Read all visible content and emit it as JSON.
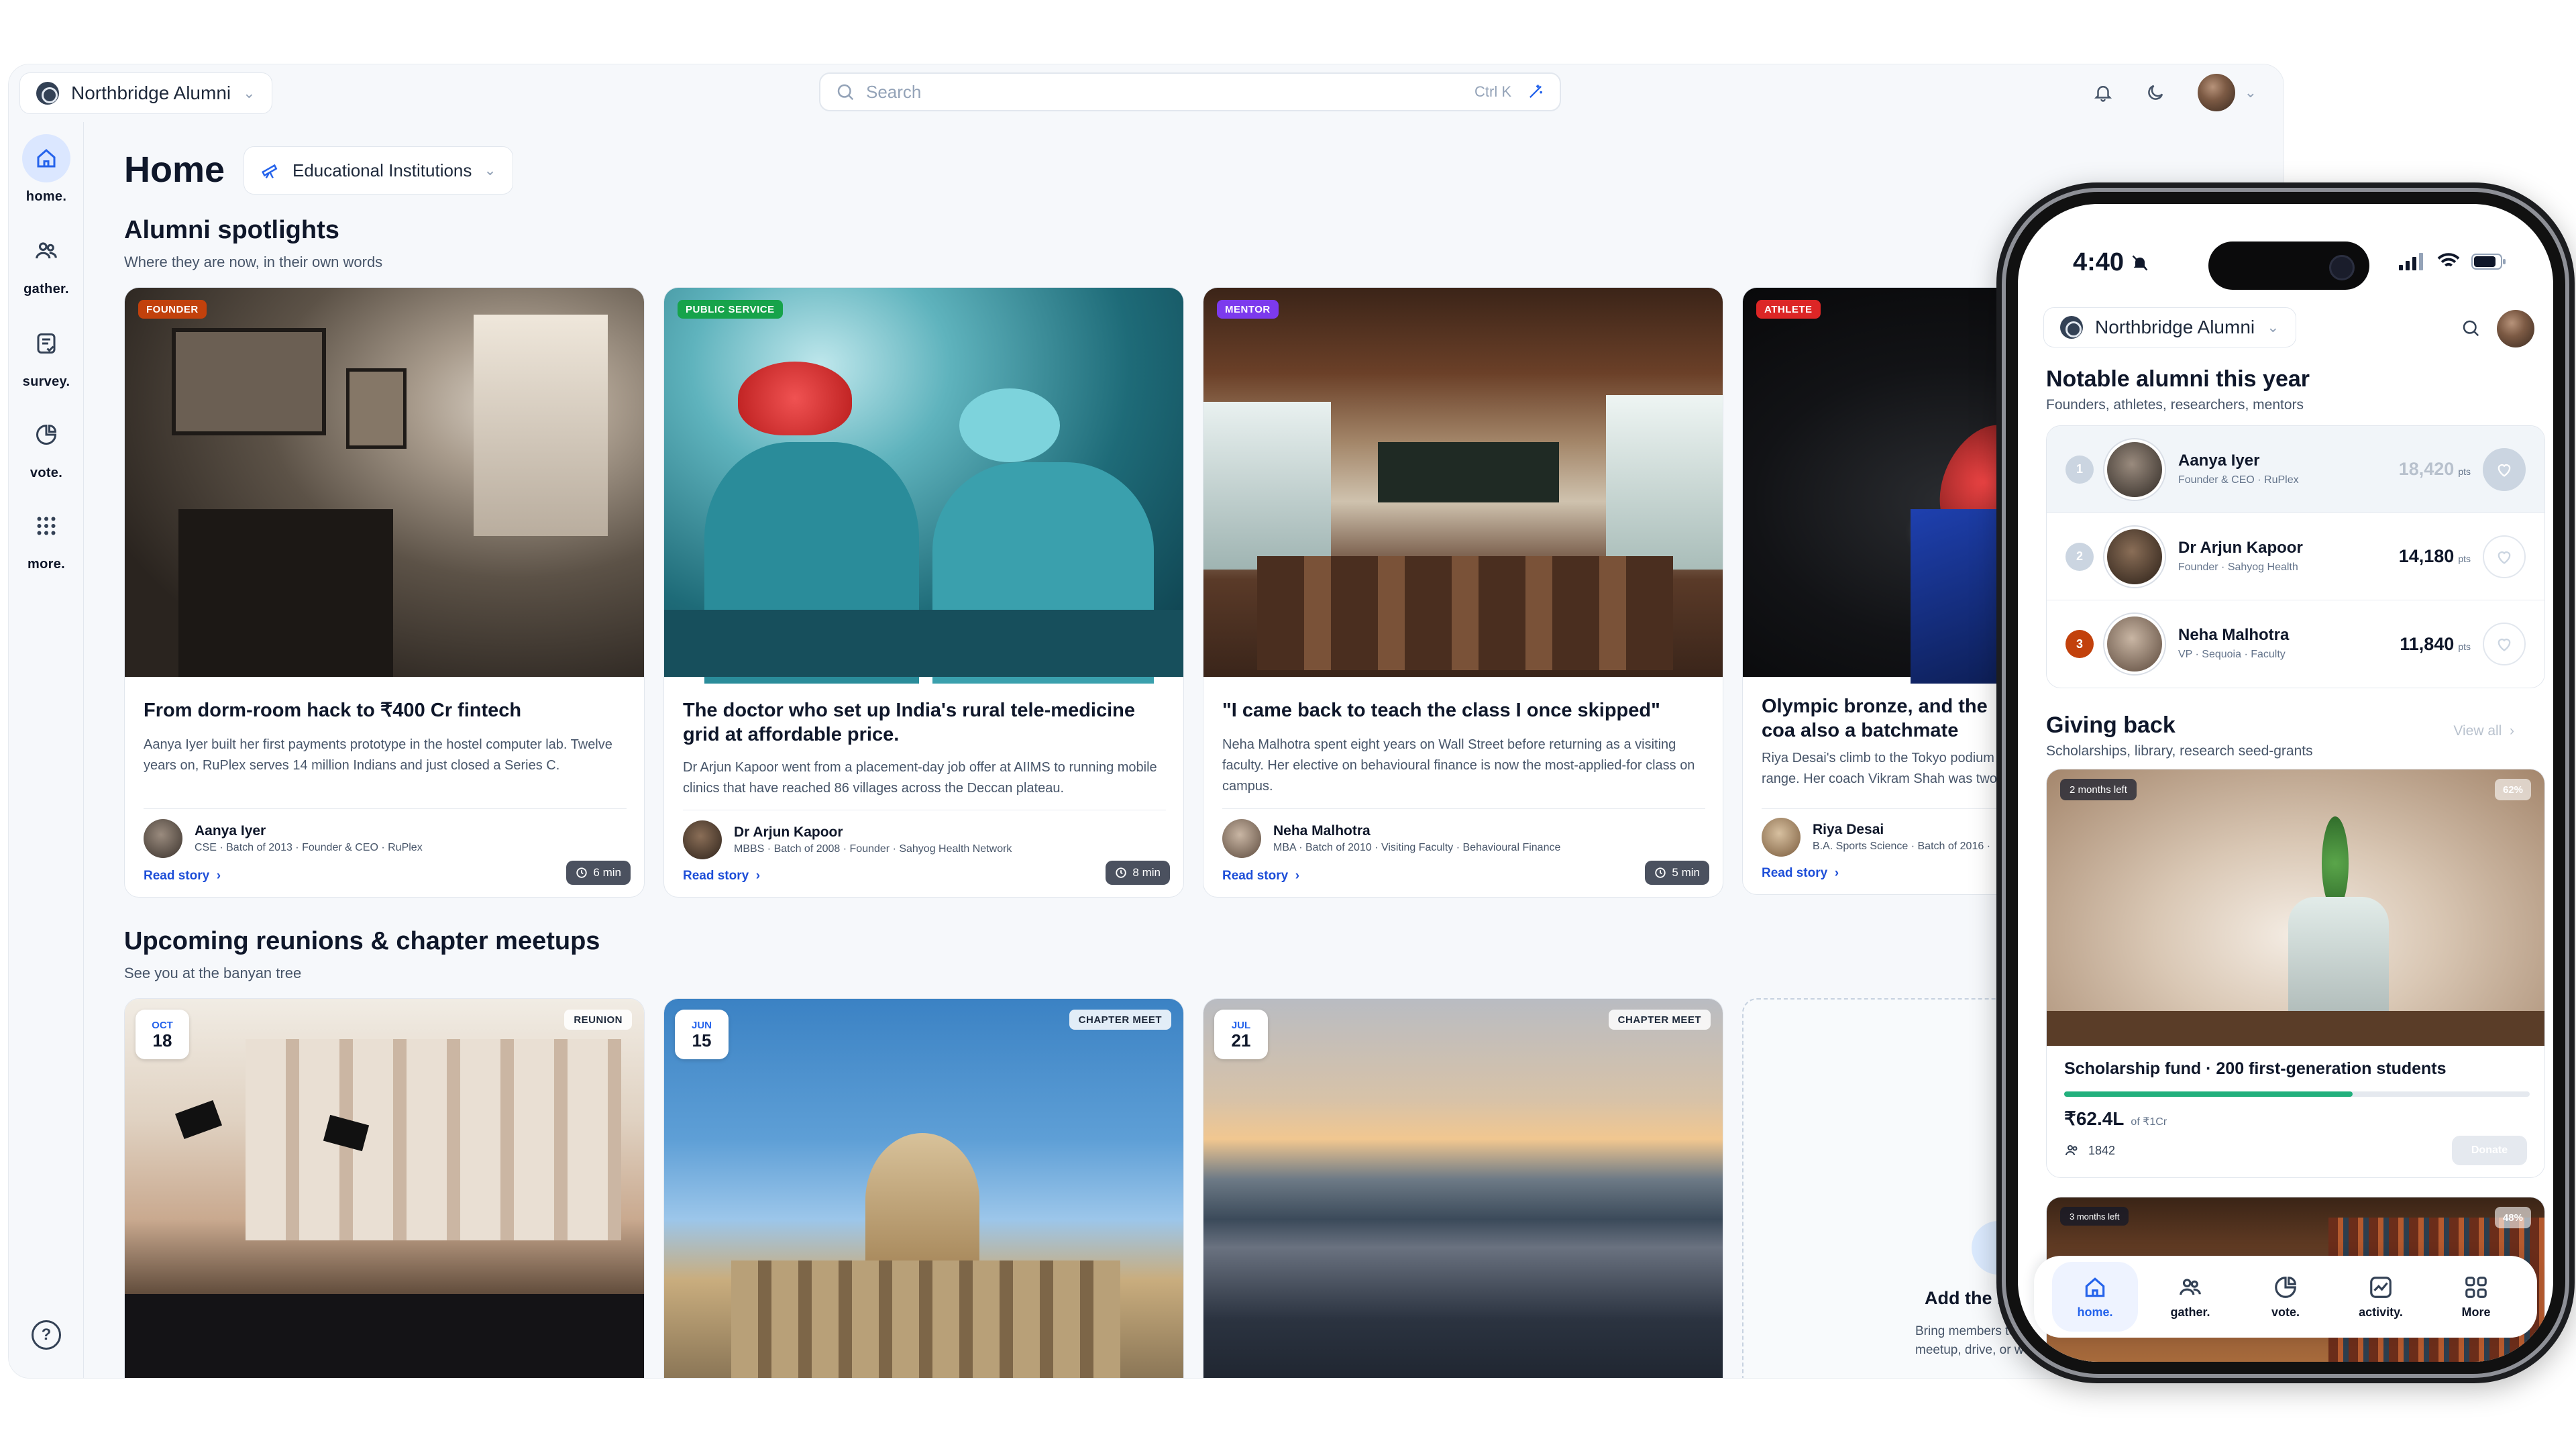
{
  "app": {
    "org_name": "Northbridge Alumni",
    "search_placeholder": "Search",
    "search_shortcut": "Ctrl K"
  },
  "sidebar": {
    "items": [
      {
        "label": "home.",
        "icon": "home-icon"
      },
      {
        "label": "gather.",
        "icon": "people-icon"
      },
      {
        "label": "survey.",
        "icon": "survey-icon"
      },
      {
        "label": "vote.",
        "icon": "pie-icon"
      },
      {
        "label": "more.",
        "icon": "grid-icon"
      }
    ],
    "help": "?"
  },
  "home": {
    "title": "Home",
    "institution_filter": "Educational Institutions",
    "spotlights": {
      "title": "Alumni spotlights",
      "subtitle": "Where they are now, in their own words",
      "cards": [
        {
          "tag": "FOUNDER",
          "tag_color": "#c2410c",
          "read_time": "6 min",
          "title": "From dorm-room hack to ₹400 Cr fintech",
          "desc": "Aanya Iyer built her first payments prototype in the hostel computer lab. Twelve years on, RuPlex serves 14 million Indians and just closed a Series C.",
          "author": "Aanya Iyer",
          "meta": "CSE · Batch of 2013 · Founder & CEO · RuPlex",
          "cta": "Read story"
        },
        {
          "tag": "PUBLIC SERVICE",
          "tag_color": "#16a34a",
          "read_time": "8 min",
          "title": "The doctor who set up India's rural tele-medicine grid at affordable price.",
          "desc": "Dr Arjun Kapoor went from a placement-day job offer at AIIMS to running mobile clinics that have reached 86 villages across the Deccan plateau.",
          "author": "Dr Arjun Kapoor",
          "meta": "MBBS · Batch of 2008 · Founder · Sahyog Health Network",
          "cta": "Read story"
        },
        {
          "tag": "MENTOR",
          "tag_color": "#7c3aed",
          "read_time": "5 min",
          "title": "\"I came back to teach the class I once skipped\"",
          "desc": "Neha Malhotra spent eight years on Wall Street before returning as a visiting faculty. Her elective on behavioural finance is now the most-applied-for class on campus.",
          "author": "Neha Malhotra",
          "meta": "MBA · Batch of 2010 · Visiting Faculty · Behavioural Finance",
          "cta": "Read story"
        },
        {
          "tag": "ATHLETE",
          "tag_color": "#dc2626",
          "read_time": "",
          "title": "Olympic bronze, and the coa also a batchmate",
          "desc": "Riya Desai's climb to the Tokyo podium range. Her coach Vikram Shah was two",
          "author": "Riya Desai",
          "meta": "B.A. Sports Science · Batch of 2016 ·",
          "cta": "Read story"
        }
      ]
    },
    "events": {
      "title": "Upcoming reunions & chapter meetups",
      "subtitle": "See you at the banyan tree",
      "cards": [
        {
          "month": "OCT",
          "day": "18",
          "tag": "REUNION"
        },
        {
          "month": "JUN",
          "day": "15",
          "tag": "CHAPTER MEET"
        },
        {
          "month": "JUL",
          "day": "21",
          "tag": "CHAPTER MEET"
        }
      ],
      "add_card": {
        "title": "Add the ne",
        "desc_line1": "Bring members to",
        "desc_line2": "meetup, drive, or w"
      }
    }
  },
  "phone": {
    "time": "4:40",
    "org_name": "Northbridge Alumni",
    "notable": {
      "title": "Notable alumni this year",
      "subtitle": "Founders, athletes, researchers, mentors",
      "rows": [
        {
          "rank": "1",
          "name": "Aanya Iyer",
          "meta": "Founder & CEO · RuPlex",
          "points": "18,420",
          "unit": "pts",
          "rank_color": "#cbd5e1"
        },
        {
          "rank": "2",
          "name": "Dr Arjun Kapoor",
          "meta": "Founder · Sahyog Health",
          "points": "14,180",
          "unit": "pts",
          "rank_color": "#cbd5e1"
        },
        {
          "rank": "3",
          "name": "Neha Malhotra",
          "meta": "VP · Sequoia · Faculty",
          "points": "11,840",
          "unit": "pts",
          "rank_color": "#c2410c"
        }
      ]
    },
    "giving": {
      "title": "Giving back",
      "subtitle": "Scholarships, library, research seed-grants",
      "view_all": "View all",
      "funds": [
        {
          "time_left": "2 months left",
          "percent_label": "62%",
          "progress": 0.62,
          "title": "Scholarship fund · 200 first-generation students",
          "raised": "₹62.4L",
          "of": "of ₹1Cr",
          "donors": "1842",
          "cta": "Donate"
        },
        {
          "time_left": "3 months left",
          "percent_label": "48%"
        }
      ]
    },
    "tabs": [
      {
        "label": "home.",
        "icon": "home-icon"
      },
      {
        "label": "gather.",
        "icon": "people-icon"
      },
      {
        "label": "vote.",
        "icon": "pie-icon"
      },
      {
        "label": "activity.",
        "icon": "activity-icon"
      },
      {
        "label": "More",
        "icon": "grid-icon"
      }
    ]
  }
}
